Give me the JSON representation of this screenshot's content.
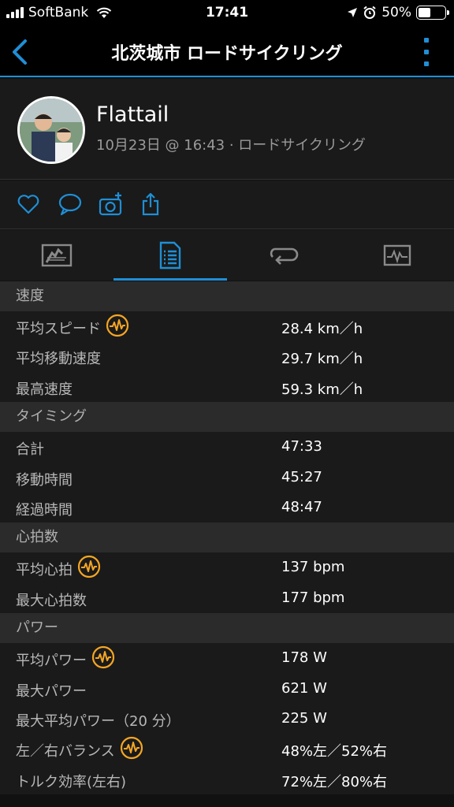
{
  "status_bar": {
    "carrier": "SoftBank",
    "time": "17:41",
    "battery": "50%",
    "battery_level": 0.5
  },
  "nav": {
    "title": "北茨城市 ロードサイクリング",
    "accent_color": "#1f8fd6"
  },
  "profile": {
    "name": "Flattail",
    "meta": "10月23日 @ 16:43 · ロードサイクリング"
  },
  "actions": [
    "heart-icon",
    "comment-icon",
    "camera-add-icon",
    "share-icon"
  ],
  "tabs": [
    {
      "icon": "map-icon"
    },
    {
      "icon": "stats-list-icon",
      "active": true
    },
    {
      "icon": "laps-icon"
    },
    {
      "icon": "chart-icon"
    }
  ],
  "sections": [
    {
      "title": "速度",
      "rows": [
        {
          "label": "平均スピード",
          "badge": true,
          "value": "28.4 km／h"
        },
        {
          "label": "平均移動速度",
          "badge": false,
          "value": "29.7 km／h"
        },
        {
          "label": "最高速度",
          "badge": false,
          "value": "59.3 km／h"
        }
      ]
    },
    {
      "title": "タイミング",
      "rows": [
        {
          "label": "合計",
          "badge": false,
          "value": "47:33"
        },
        {
          "label": "移動時間",
          "badge": false,
          "value": "45:27"
        },
        {
          "label": "経過時間",
          "badge": false,
          "value": "48:47"
        }
      ]
    },
    {
      "title": "心拍数",
      "rows": [
        {
          "label": "平均心拍",
          "badge": true,
          "value": "137 bpm"
        },
        {
          "label": "最大心拍数",
          "badge": false,
          "value": "177 bpm"
        }
      ]
    },
    {
      "title": "パワー",
      "rows": [
        {
          "label": "平均パワー",
          "badge": true,
          "value": "178 W"
        },
        {
          "label": "最大パワー",
          "badge": false,
          "value": "621 W"
        },
        {
          "label": "最大平均パワー（20 分）",
          "badge": false,
          "value": "225 W"
        },
        {
          "label": "左／右バランス",
          "badge": true,
          "value": "48%左／52%右"
        },
        {
          "label": "トルク効率(左右)",
          "badge": false,
          "value": "72%左／80%右"
        }
      ]
    }
  ],
  "badge_color": "#f5a623"
}
